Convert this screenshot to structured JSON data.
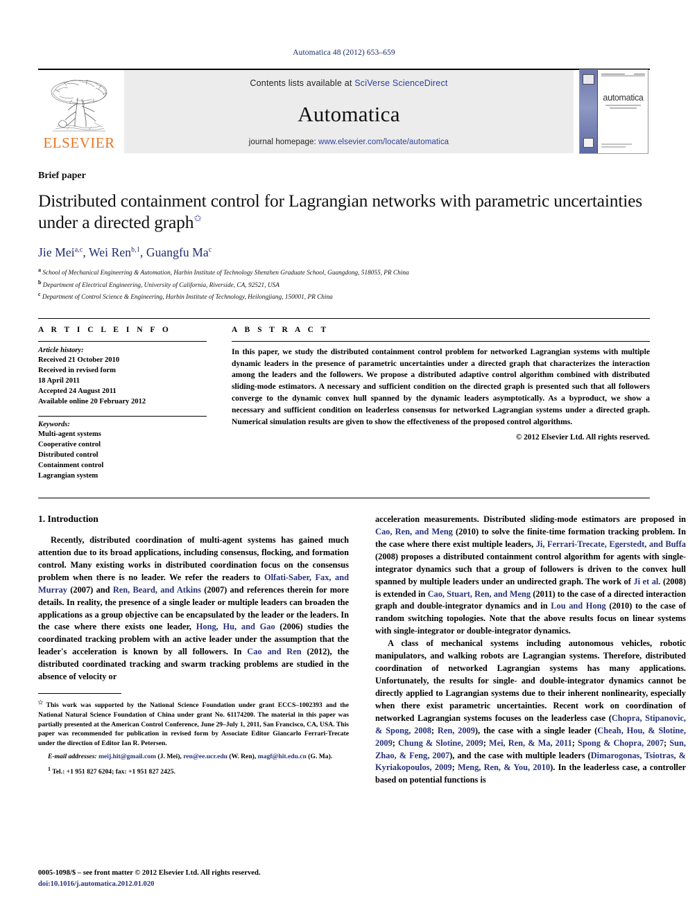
{
  "running_head": "Automatica 48 (2012) 653–659",
  "masthead": {
    "publisher": "ELSEVIER",
    "contents_prefix": "Contents lists available at ",
    "contents_link": "SciVerse ScienceDirect",
    "journal_name": "Automatica",
    "homepage_prefix": "journal homepage: ",
    "homepage_link": "www.elsevier.com/locate/automatica",
    "cover_title": "automatica",
    "cover_subtitle": "A Journal of IFAC, the International Federation of Automatic Control",
    "link_color": "#2b3f9e",
    "elsevier_orange": "#E87722"
  },
  "article": {
    "type_label": "Brief paper",
    "title": "Distributed containment control for Lagrangian networks with parametric uncertainties under a directed graph",
    "title_footnote_mark": "✩",
    "authors": "Jie Mei a,c, Wei Ren b,1, Guangfu Ma c",
    "author_list": [
      {
        "name": "Jie Mei",
        "sup": "a,c"
      },
      {
        "name": "Wei Ren",
        "sup": "b,1"
      },
      {
        "name": "Guangfu Ma",
        "sup": "c"
      }
    ],
    "affiliations": [
      {
        "mark": "a",
        "text": "School of Mechanical Engineering & Automation, Harbin Institute of Technology Shenzhen Graduate School, Guangdong, 518055, PR China"
      },
      {
        "mark": "b",
        "text": "Department of Electrical Engineering, University of California, Riverside, CA, 92521, USA"
      },
      {
        "mark": "c",
        "text": "Department of Control Science & Engineering, Harbin Institute of Technology, Heilongjiang, 150001, PR China"
      }
    ]
  },
  "article_info": {
    "heading": "A R T I C L E   I N F O",
    "history_heading": "Article history:",
    "history": [
      "Received 21 October 2010",
      "Received in revised form",
      "18 April 2011",
      "Accepted 24 August 2011",
      "Available online 20 February 2012"
    ],
    "keywords_heading": "Keywords:",
    "keywords": [
      "Multi-agent systems",
      "Cooperative control",
      "Distributed control",
      "Containment control",
      "Lagrangian system"
    ]
  },
  "abstract": {
    "heading": "A B S T R A C T",
    "text": "In this paper, we study the distributed containment control problem for networked Lagrangian systems with multiple dynamic leaders in the presence of parametric uncertainties under a directed graph that characterizes the interaction among the leaders and the followers. We propose a distributed adaptive control algorithm combined with distributed sliding-mode estimators. A necessary and sufficient condition on the directed graph is presented such that all followers converge to the dynamic convex hull spanned by the dynamic leaders asymptotically. As a byproduct, we show a necessary and sufficient condition on leaderless consensus for networked Lagrangian systems under a directed graph. Numerical simulation results are given to show the effectiveness of the proposed control algorithms.",
    "copyright": "© 2012 Elsevier Ltd. All rights reserved."
  },
  "introduction": {
    "section_title": "1. Introduction",
    "left_paragraph_1_a": "Recently, distributed coordination of multi-agent systems has gained much attention due to its broad applications, including consensus, flocking, and formation control. Many existing works in distributed coordination focus on the consensus problem when there is no leader. We refer the readers to ",
    "cite_olfati": "Olfati-Saber, Fax, and Murray",
    "left_paragraph_1_b": " (2007) and ",
    "cite_ren_beard": "Ren, Beard, and Atkins",
    "left_paragraph_1_c": " (2007) and references therein for more details. In reality, the presence of a single leader or multiple leaders can broaden the applications as a group objective can be encapsulated by the leader or the leaders. In the case where there exists one leader, ",
    "cite_hong": "Hong, Hu, and Gao",
    "left_paragraph_1_d": " (2006) studies the coordinated tracking problem with an active leader under the assumption that the leader's acceleration is known by all followers. In ",
    "cite_cao_ren": "Cao and Ren",
    "left_paragraph_1_e": " (2012), the distributed coordinated tracking and swarm tracking problems are studied in the absence of velocity or",
    "right_paragraph_1_a": "acceleration measurements. Distributed sliding-mode estimators are proposed in ",
    "cite_cao_ren_meng": "Cao, Ren, and Meng",
    "right_paragraph_1_b": " (2010) to solve the finite-time formation tracking problem. In the case where there exist multiple leaders, ",
    "cite_ji": "Ji, Ferrari-Trecate, Egerstedt, and Buffa",
    "right_paragraph_1_c": " (2008) proposes a distributed containment control algorithm for agents with single-integrator dynamics such that a group of followers is driven to the convex hull spanned by multiple leaders under an undirected graph. The work of ",
    "cite_ji_etal": "Ji et al.",
    "right_paragraph_1_d": " (2008) is extended in ",
    "cite_cao_stuart": "Cao, Stuart, Ren, and Meng",
    "right_paragraph_1_e": " (2011) to the case of a directed interaction graph and double-integrator dynamics and in ",
    "cite_lou_hong": "Lou and Hong",
    "right_paragraph_1_f": " (2010) to the case of random switching topologies. Note that the above results focus on linear systems with single-integrator or double-integrator dynamics.",
    "right_paragraph_2_a": "A class of mechanical systems including autonomous vehicles, robotic manipulators, and walking robots are Lagrangian systems. Therefore, distributed coordination of networked Lagrangian systems has many applications. Unfortunately, the results for single- and double-integrator dynamics cannot be directly applied to Lagrangian systems due to their inherent nonlinearity, especially when there exist parametric uncertainties. Recent work on coordination of networked Lagrangian systems focuses on the leaderless case (",
    "cite_chopra": "Chopra, Stipanovic, & Spong, 2008",
    "right_paragraph_2_b": "; ",
    "cite_ren2009": "Ren, 2009",
    "right_paragraph_2_c": "), the case with a single leader (",
    "cite_cheah": "Cheah, Hou, & Slotine, 2009",
    "right_paragraph_2_d": "; ",
    "cite_chung": "Chung & Slotine, 2009",
    "right_paragraph_2_e": "; ",
    "cite_mei": "Mei, Ren, & Ma, 2011",
    "right_paragraph_2_f": "; ",
    "cite_spong": "Spong & Chopra, 2007",
    "right_paragraph_2_g": "; ",
    "cite_sun": "Sun, Zhao, & Feng, 2007",
    "right_paragraph_2_h": "), and the case with multiple leaders (",
    "cite_dimarogonas": "Dimarogonas, Tsiotras, & Kyriakopoulos, 2009",
    "right_paragraph_2_i": "; ",
    "cite_meng": "Meng, Ren, & You, 2010",
    "right_paragraph_2_j": "). In the leaderless case, a controller based on potential functions is"
  },
  "footnotes": {
    "star_mark": "✩",
    "star_text": "This work was supported by the National Science Foundation under grant ECCS–1002393 and the National Natural Science Foundation of China under grant No. 61174200. The material in this paper was partially presented at the American Control Conference, June 29–July 1, 2011, San Francisco, CA, USA. This paper was recommended for publication in revised form by Associate Editor Giancarlo Ferrari-Trecate under the direction of Editor Ian R. Petersen.",
    "email_label": "E-mail addresses:",
    "emails": [
      {
        "address": "meij.hit@gmail.com",
        "who": " (J. Mei)"
      },
      {
        "address": "ren@ee.ucr.edu",
        "who": " (W. Ren)"
      },
      {
        "address": "magf@hit.edu.cn",
        "who": " (G. Ma)"
      }
    ],
    "tel_mark": "1",
    "tel_text": "Tel.: +1 951 827 6204; fax: +1 951 827 2425."
  },
  "imprint": {
    "line1": "0005-1098/$ – see front matter © 2012 Elsevier Ltd. All rights reserved.",
    "doi": "doi:10.1016/j.automatica.2012.01.020"
  }
}
